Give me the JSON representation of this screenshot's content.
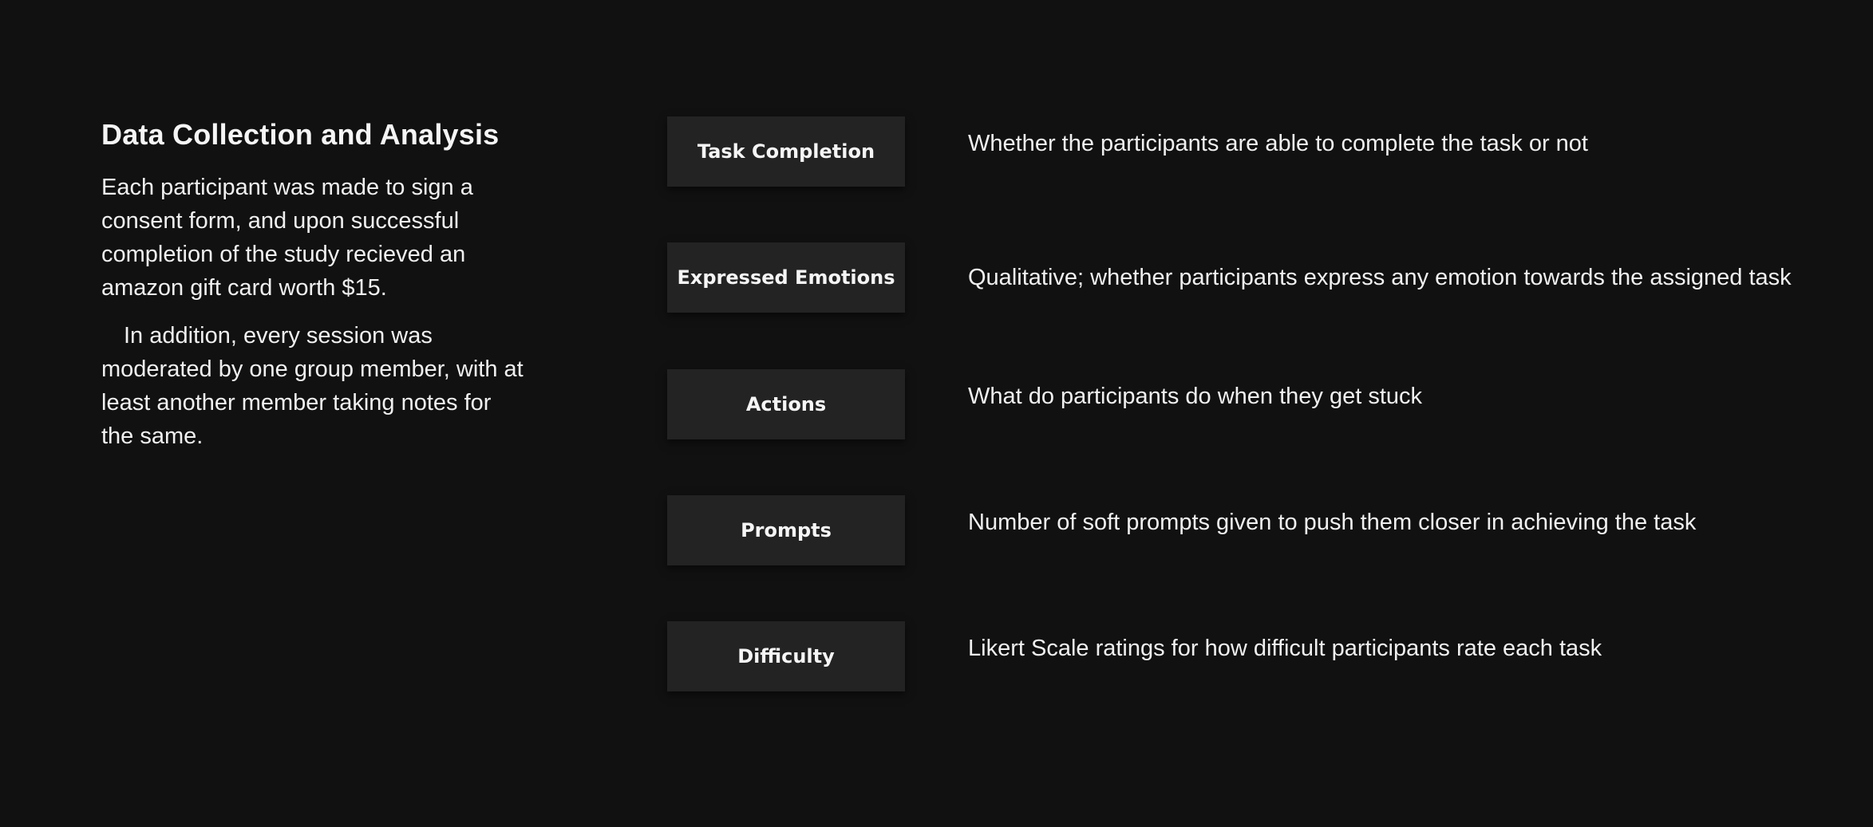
{
  "section": {
    "title": "Data Collection and Analysis",
    "paragraphs": [
      "Each participant was made to sign a consent form, and upon successful completion of the study recieved an amazon gift card worth $15.",
      "In addition, every session was moderated by one group member, with at least another member taking notes for the same."
    ]
  },
  "metrics": [
    {
      "label": "Task Completion",
      "description": "Whether the participants are able to complete the task or not"
    },
    {
      "label": "Expressed Emotions",
      "description": "Qualitative; whether participants express any emotion towards the assigned task"
    },
    {
      "label": "Actions",
      "description": "What do participants do when they get stuck"
    },
    {
      "label": "Prompts",
      "description": "Number of soft prompts given to push them closer in achieving the task"
    },
    {
      "label": "Difficulty",
      "description": "Likert Scale ratings for how difficult participants rate each task"
    }
  ],
  "colors": {
    "background": "#111111",
    "box": "#232323",
    "text": "#f0f0f0"
  }
}
